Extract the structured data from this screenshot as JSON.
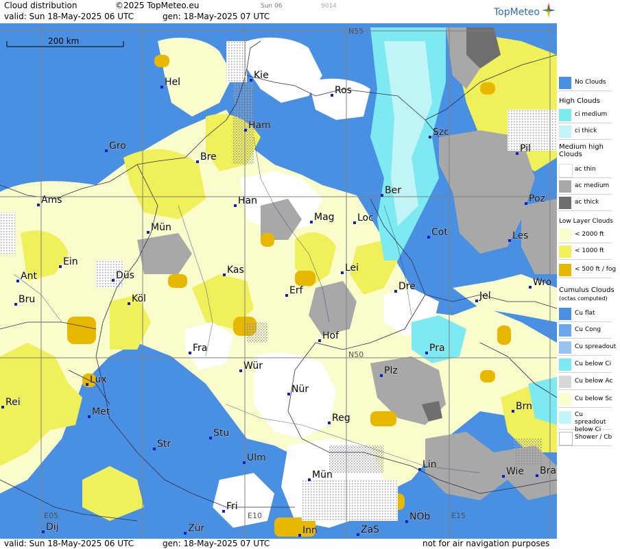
{
  "header": {
    "title": "Cloud distribution",
    "copyright": "©2025 TopMeteo.eu",
    "frame_label": "Sun 06",
    "frame_code": "9014",
    "valid": "valid:  Sun  18-May-2025  06 UTC",
    "gen": "gen: 18-May-2025 07 UTC",
    "logo": "TopMeteo"
  },
  "footer": {
    "valid": "valid:  Sun  18-May-2025  06 UTC",
    "gen": "gen: 18-May-2025 07 UTC",
    "disclaimer": "not for air navigation purposes"
  },
  "map": {
    "scale_label": "200 km",
    "grid_labels": [
      "N55",
      "N50",
      "E05",
      "E10",
      "E15"
    ],
    "cities": [
      "Hel",
      "Kie",
      "Ros",
      "Ham",
      "Szc",
      "Gro",
      "Bre",
      "Pil",
      "Ber",
      "Ams",
      "Han",
      "Poz",
      "Mag",
      "Loc",
      "Mün",
      "Cot",
      "Les",
      "Ein",
      "Lei",
      "Kas",
      "Ant",
      "Düs",
      "Wro",
      "Dre",
      "Bru",
      "Erf",
      "Jel",
      "Köl",
      "Hof",
      "Fra",
      "Pra",
      "Lux",
      "Würz",
      "Plz",
      "Rei",
      "Nür",
      "Met",
      "Brn",
      "Reg",
      "Stu",
      "Str",
      "Lin",
      "Wie",
      "Bra",
      "Ulm",
      "Münc",
      "Fri",
      "Dij",
      "Zür",
      "NÖb",
      "Inn",
      "ZaS"
    ]
  },
  "city_labels": {
    "Hel": "Hel",
    "Kie": "Kie",
    "Ros": "Ros",
    "Ham": "Ham",
    "Szc": "Szc",
    "Gro": "Gro",
    "Bre": "Bre",
    "Pil": "Pil",
    "Ber": "Ber",
    "Ams": "Ams",
    "Han": "Han",
    "Poz": "Poz",
    "Mag": "Mag",
    "Loc": "Loc",
    "Mün": "Mün",
    "Cot": "Cot",
    "Les": "Les",
    "Ein": "Ein",
    "Lei": "Lei",
    "Kas": "Kas",
    "Ant": "Ant",
    "Düs": "Düs",
    "Wro": "Wro",
    "Dre": "Dre",
    "Bru": "Bru",
    "Erf": "Erf",
    "Jel": "Jel",
    "Köl": "Köl",
    "Hof": "Hof",
    "Fra": "Fra",
    "Pra": "Pra",
    "Lux": "Lux",
    "Würz": "Wür",
    "Plz": "Plz",
    "Rei": "Rei",
    "Nür": "Nür",
    "Met": "Met",
    "Brn": "Brn",
    "Reg": "Reg",
    "Stu": "Stu",
    "Str": "Str",
    "Lin": "Lin",
    "Wie": "Wie",
    "Bra": "Bra",
    "Ulm": "Ulm",
    "Münc": "Mün",
    "Fri": "Fri",
    "Dij": "Dij",
    "Zür": "Zür",
    "NÖb": "NÖb",
    "Inn": "Inn",
    "ZaS": "ZaS"
  },
  "legend": {
    "no_clouds": "No Clouds",
    "high_title": "High Clouds",
    "ci_medium": "ci medium",
    "ci_thick": "ci thick",
    "medium_title": "Medium high Clouds",
    "ac_thin": "ac thin",
    "ac_medium": "ac medium",
    "ac_thick": "ac thick",
    "low_title": "Low Layer Clouds",
    "low_2000": "< 2000 ft",
    "low_1000": "< 1000 ft",
    "low_500": "< 500 ft / fog",
    "cu_title": "Cumulus Clouds",
    "cu_sub": "(octas computed)",
    "cu_flat": "Cu flat",
    "cu_cong": "Cu Cong",
    "cu_spreadout": "Cu spreadout",
    "cu_below_ci": "Cu below Ci",
    "cu_below_ac": "Cu below Ac",
    "cu_below_sc": "Cu below Sc",
    "cu_spread_ci": "Cu spreadout below Ci",
    "shower": "Shower / Cb"
  },
  "colors": {
    "no_clouds": "#4a90e2",
    "ci_medium": "#7de9f0",
    "ci_thick": "#c0f4f7",
    "ac_thin": "#ffffff",
    "ac_medium": "#a8a8a8",
    "ac_thick": "#6e6e6e",
    "low_2000": "#fafccc",
    "low_1000": "#f0f05a",
    "low_500": "#e8b800"
  }
}
